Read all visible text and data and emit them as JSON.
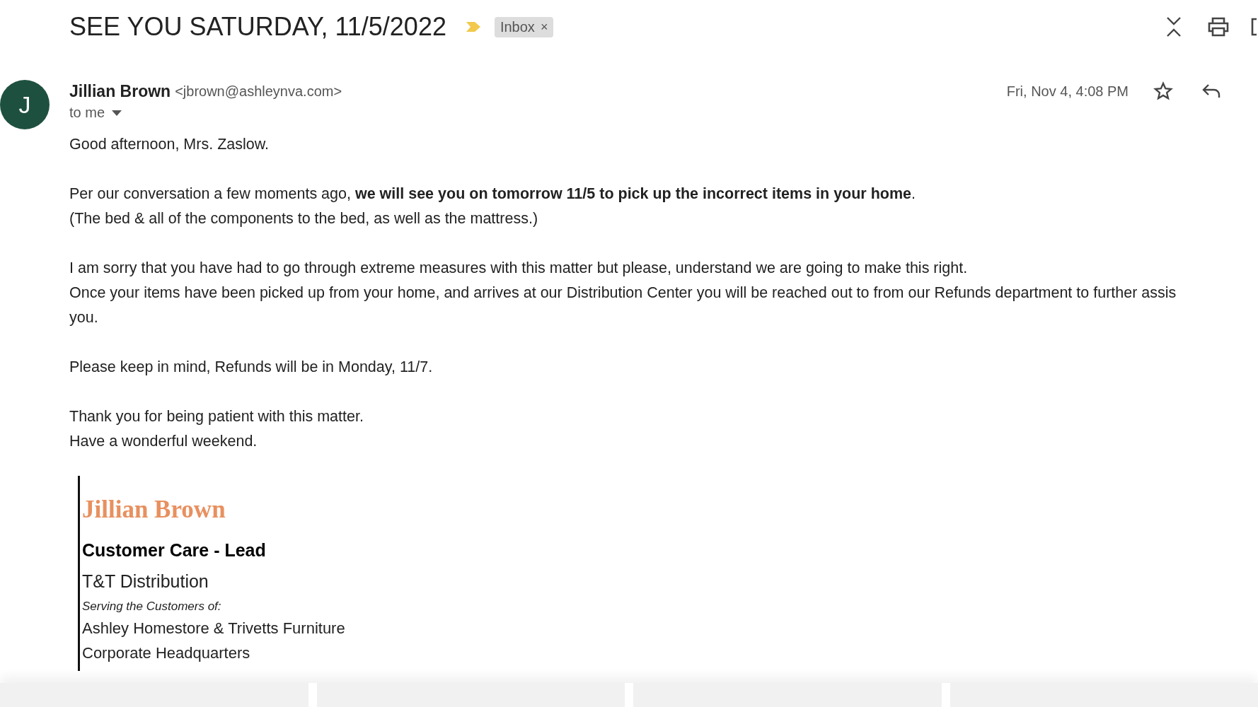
{
  "subject": "SEE YOU SATURDAY, 11/5/2022",
  "label": {
    "text": "Inbox",
    "remove": "×"
  },
  "sender": {
    "initial": "J",
    "name": "Jillian Brown",
    "email": "<jbrown@ashleynva.com>",
    "recipient": "to me",
    "date": "Fri, Nov 4, 4:08 PM",
    "starred": false
  },
  "body": [
    [
      "Good afternoon, Mrs. Zaslow."
    ],
    [
      "Per our conversation a few moments ago, **we will see you on tomorrow 11/5 to pick up the incorrect items in your home**.",
      "(The bed & all of the components to the bed, as well as the mattress.)"
    ],
    [
      "I am sorry that you have had to go through extreme measures with this matter but please, understand we are going to make this right.",
      "Once your items have been picked up from your home, and arrives at our Distribution Center you will be reached out to from our Refunds department to further assis",
      "you."
    ],
    [
      "Please keep in mind, Refunds will be in Monday, 11/7."
    ],
    [
      "Thank you for being patient with this matter.",
      "Have a wonderful weekend."
    ]
  ],
  "signature": {
    "name": "Jillian Brown",
    "title": "Customer Care - Lead",
    "company": "T&T Distribution",
    "serving": "Serving the Customers of:",
    "lines": [
      "Ashley Homestore & Trivetts Furniture",
      "Corporate Headquarters"
    ]
  }
}
